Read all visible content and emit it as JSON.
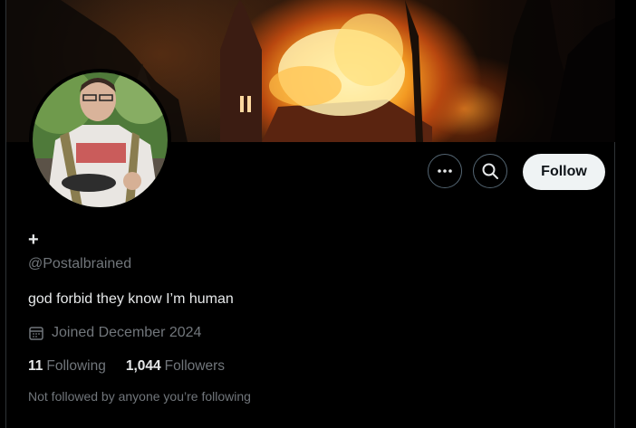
{
  "profile": {
    "display_name": "+",
    "handle": "@Postalbrained",
    "bio": "god forbid they know I’m human",
    "joined": "Joined December 2024",
    "not_followed_note": "Not followed by anyone you’re following"
  },
  "stats": {
    "following_count": "11",
    "following_label": "Following",
    "followers_count": "1,044",
    "followers_label": "Followers"
  },
  "actions": {
    "more_icon": "more-icon",
    "search_icon": "search-icon",
    "follow_label": "Follow"
  },
  "colors": {
    "background": "#000000",
    "primary_text": "#e7e9ea",
    "secondary_text": "#71767b",
    "follow_button_bg": "#eff3f4",
    "border": "#2f3336"
  }
}
